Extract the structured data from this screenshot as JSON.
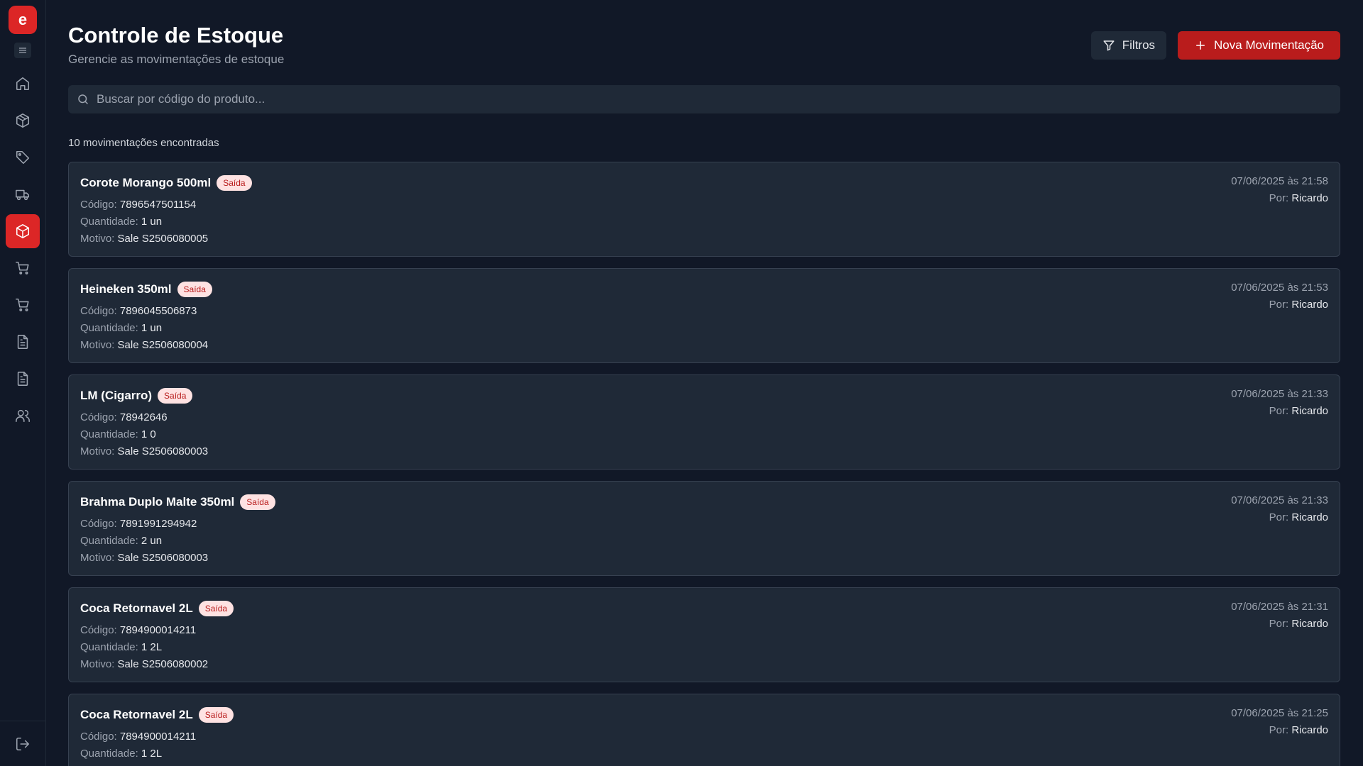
{
  "logo": {
    "letter": "e",
    "color": "#dc2626"
  },
  "sidebar": {
    "items": [
      {
        "icon": "home-icon"
      },
      {
        "icon": "box-icon"
      },
      {
        "icon": "tag-icon"
      },
      {
        "icon": "truck-icon"
      },
      {
        "icon": "box-icon",
        "active": true
      },
      {
        "icon": "cart-icon"
      },
      {
        "icon": "cart-icon"
      },
      {
        "icon": "document-icon"
      },
      {
        "icon": "document-icon"
      },
      {
        "icon": "users-icon"
      }
    ],
    "bottom": {
      "icon": "logout-icon"
    }
  },
  "header": {
    "title": "Controle de Estoque",
    "subtitle": "Gerencie as movimentações de estoque",
    "filter_label": "Filtros",
    "new_label": "Nova Movimentação"
  },
  "search": {
    "placeholder": "Buscar por código do produto..."
  },
  "result_count": "10 movimentações encontradas",
  "labels": {
    "code": "Código:",
    "quantity": "Quantidade:",
    "reason": "Motivo:",
    "by": "Por:"
  },
  "movements": [
    {
      "name": "Corote Morango 500ml",
      "type": "Saída",
      "code": "7896547501154",
      "quantity": "1 un",
      "reason": "Sale S2506080005",
      "date": "07/06/2025 às 21:58",
      "user": "Ricardo"
    },
    {
      "name": "Heineken 350ml",
      "type": "Saída",
      "code": "7896045506873",
      "quantity": "1 un",
      "reason": "Sale S2506080004",
      "date": "07/06/2025 às 21:53",
      "user": "Ricardo"
    },
    {
      "name": "LM (Cigarro)",
      "type": "Saída",
      "code": "78942646",
      "quantity": "1 0",
      "reason": "Sale S2506080003",
      "date": "07/06/2025 às 21:33",
      "user": "Ricardo"
    },
    {
      "name": "Brahma Duplo Malte 350ml",
      "type": "Saída",
      "code": "7891991294942",
      "quantity": "2 un",
      "reason": "Sale S2506080003",
      "date": "07/06/2025 às 21:33",
      "user": "Ricardo"
    },
    {
      "name": "Coca Retornavel 2L",
      "type": "Saída",
      "code": "7894900014211",
      "quantity": "1 2L",
      "reason": "Sale S2506080002",
      "date": "07/06/2025 às 21:31",
      "user": "Ricardo"
    },
    {
      "name": "Coca Retornavel 2L",
      "type": "Saída",
      "code": "7894900014211",
      "quantity": "1 2L",
      "reason": "",
      "date": "07/06/2025 às 21:25",
      "user": "Ricardo"
    }
  ]
}
